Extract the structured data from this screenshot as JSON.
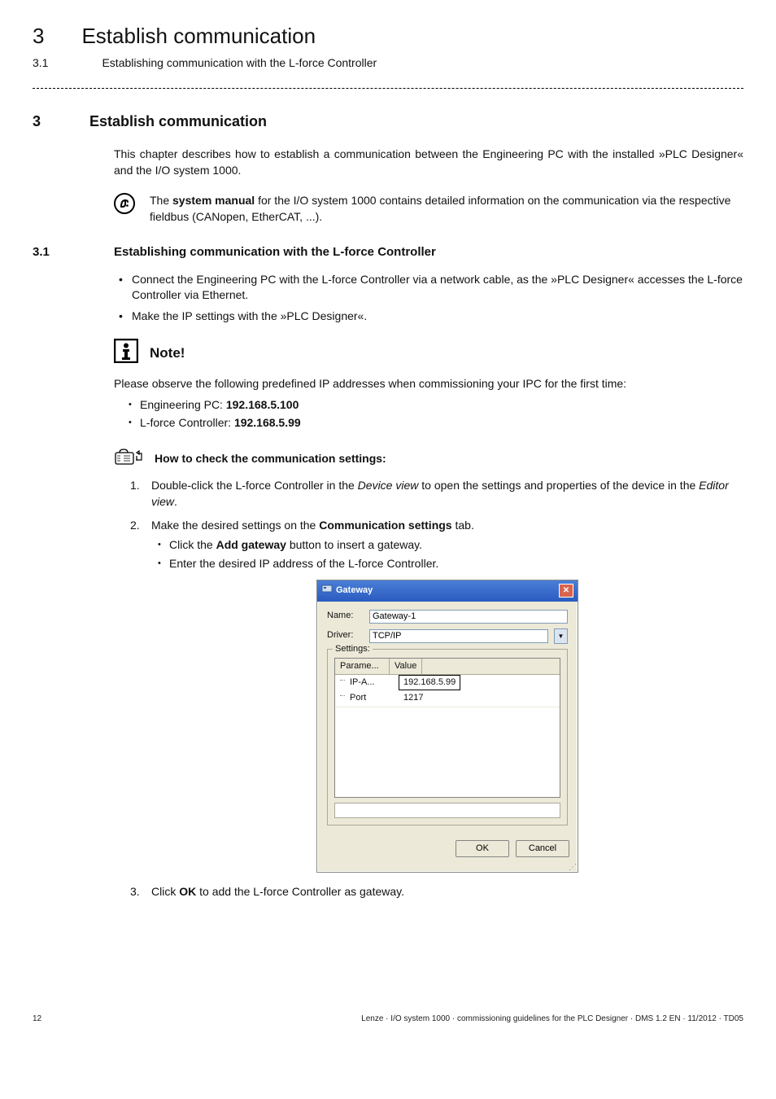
{
  "header": {
    "chapter_num": "3",
    "chapter_title": "Establish communication",
    "section_num": "3.1",
    "section_title": "Establishing communication with the L-force Controller"
  },
  "h2": {
    "num": "3",
    "title": "Establish communication"
  },
  "intro": "This chapter describes how to establish a communication between the Engineering PC with the installed »PLC Designer« and the I/O system 1000.",
  "tip": {
    "pre": "The ",
    "bold": "system manual",
    "post": " for the I/O system 1000 contains detailed information on the communication via the respective fieldbus (CANopen, EtherCAT, ...)."
  },
  "s31": {
    "num": "3.1",
    "title": "Establishing communication with the L-force Controller"
  },
  "bul": {
    "a": "Connect the Engineering PC with the L-force Controller via a network cable, as the »PLC Designer« accesses the L-force Controller via Ethernet.",
    "b": "Make the IP settings with the »PLC Designer«."
  },
  "note": {
    "title": "Note!",
    "body": "Please observe the following predefined IP addresses when commissioning your IPC for the first time:",
    "li1_pre": "Engineering PC: ",
    "li1_b": "192.168.5.100",
    "li2_pre": "L-force Controller: ",
    "li2_b": "192.168.5.99"
  },
  "howto": "How to check the communication settings:",
  "steps": {
    "s1": {
      "pre": "Double-click the L-force Controller in the ",
      "i1": "Device view",
      "mid": " to open the settings and properties of the device in the ",
      "i2": "Editor view",
      "post": "."
    },
    "s2": {
      "pre": "Make the desired settings on the ",
      "b": "Communication settings",
      "post": " tab.",
      "sa_pre": "Click the ",
      "sa_b": "Add gateway",
      "sa_post": " button to insert a gateway.",
      "sb": "Enter the desired IP address of the L-force Controller."
    },
    "s3": {
      "pre": "Click ",
      "b": "OK",
      "post": " to add the L-force Controller as gateway."
    }
  },
  "dlg": {
    "title": "Gateway",
    "name_lbl": "Name:",
    "name_val": "Gateway-1",
    "driver_lbl": "Driver:",
    "driver_val": "TCP/IP",
    "settings": "Settings:",
    "col1": "Parame...",
    "col2": "Value",
    "r1c1": "IP-A...",
    "r1c2": "192.168.5.99",
    "r2c1": "Port",
    "r2c2": "1217",
    "ok": "OK",
    "cancel": "Cancel"
  },
  "footer": {
    "page": "12",
    "text": "Lenze · I/O system 1000 · commissioning guidelines for the PLC Designer · DMS 1.2 EN · 11/2012 · TD05"
  }
}
